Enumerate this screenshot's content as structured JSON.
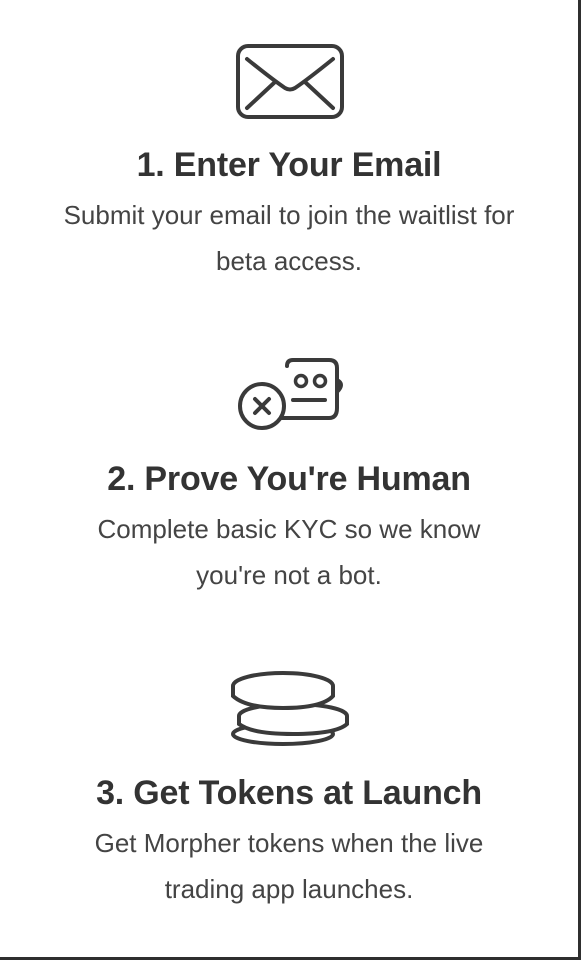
{
  "steps": [
    {
      "icon": "envelope-icon",
      "title": "1. Enter Your Email",
      "description": "Submit your email to join the waitlist for beta access."
    },
    {
      "icon": "robot-cross-icon",
      "title": "2. Prove You're Human",
      "description": "Complete basic KYC so we know you're not a bot."
    },
    {
      "icon": "coins-stack-icon",
      "title": "3. Get Tokens at Launch",
      "description": "Get Morpher tokens when the live trading app launches."
    }
  ],
  "colors": {
    "text": "#333333",
    "icon_stroke": "#3a3a3a",
    "background": "#ffffff"
  }
}
